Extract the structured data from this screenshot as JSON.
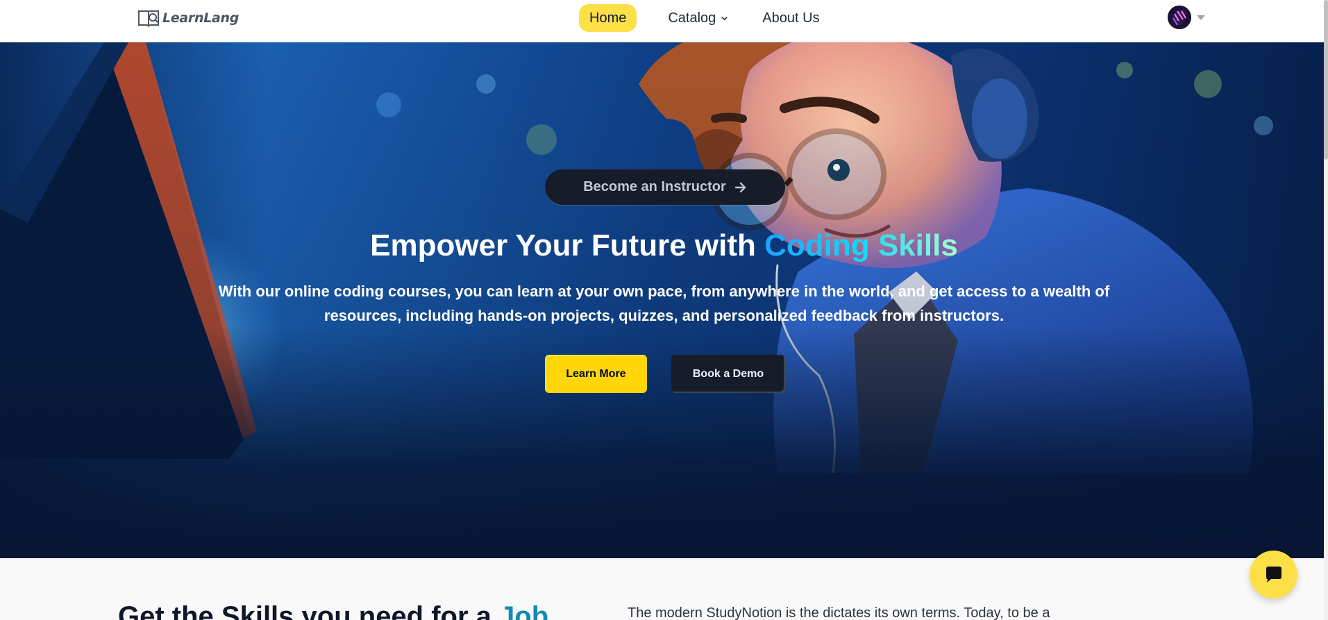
{
  "brand": {
    "name": "LearnLang"
  },
  "nav": {
    "home": "Home",
    "catalog": "Catalog",
    "about": "About Us"
  },
  "icons": {
    "logo": "book-icon",
    "catalog_dropdown": "chevron-down-icon",
    "profile_dropdown": "caret-down-icon",
    "pill_arrow": "arrow-right-icon",
    "chat": "chat-bubble-icon"
  },
  "hero": {
    "pill_label": "Become an Instructor",
    "title_start": "Empower Your Future with ",
    "title_highlight": "Coding Skills",
    "subtitle": "With our online coding courses, you can learn at your own pace, from anywhere in the world, and get access to a wealth of resources, including hands-on projects, quizzes, and personalized feedback from instructors.",
    "learn_more": "Learn More",
    "book_demo": "Book a Demo"
  },
  "section2": {
    "title_start": "Get the Skills you need for a ",
    "title_highlight": "Job",
    "text": "The modern StudyNotion is the dictates its own terms. Today, to be a"
  },
  "colors": {
    "accent_yellow": "#ffd60a",
    "nav_active": "#fde047",
    "dark_button": "#161d29",
    "highlight_gradient_start": "#1fa2ff",
    "highlight_gradient_end": "#a6ffcb",
    "job_blue": "#118ab2"
  }
}
